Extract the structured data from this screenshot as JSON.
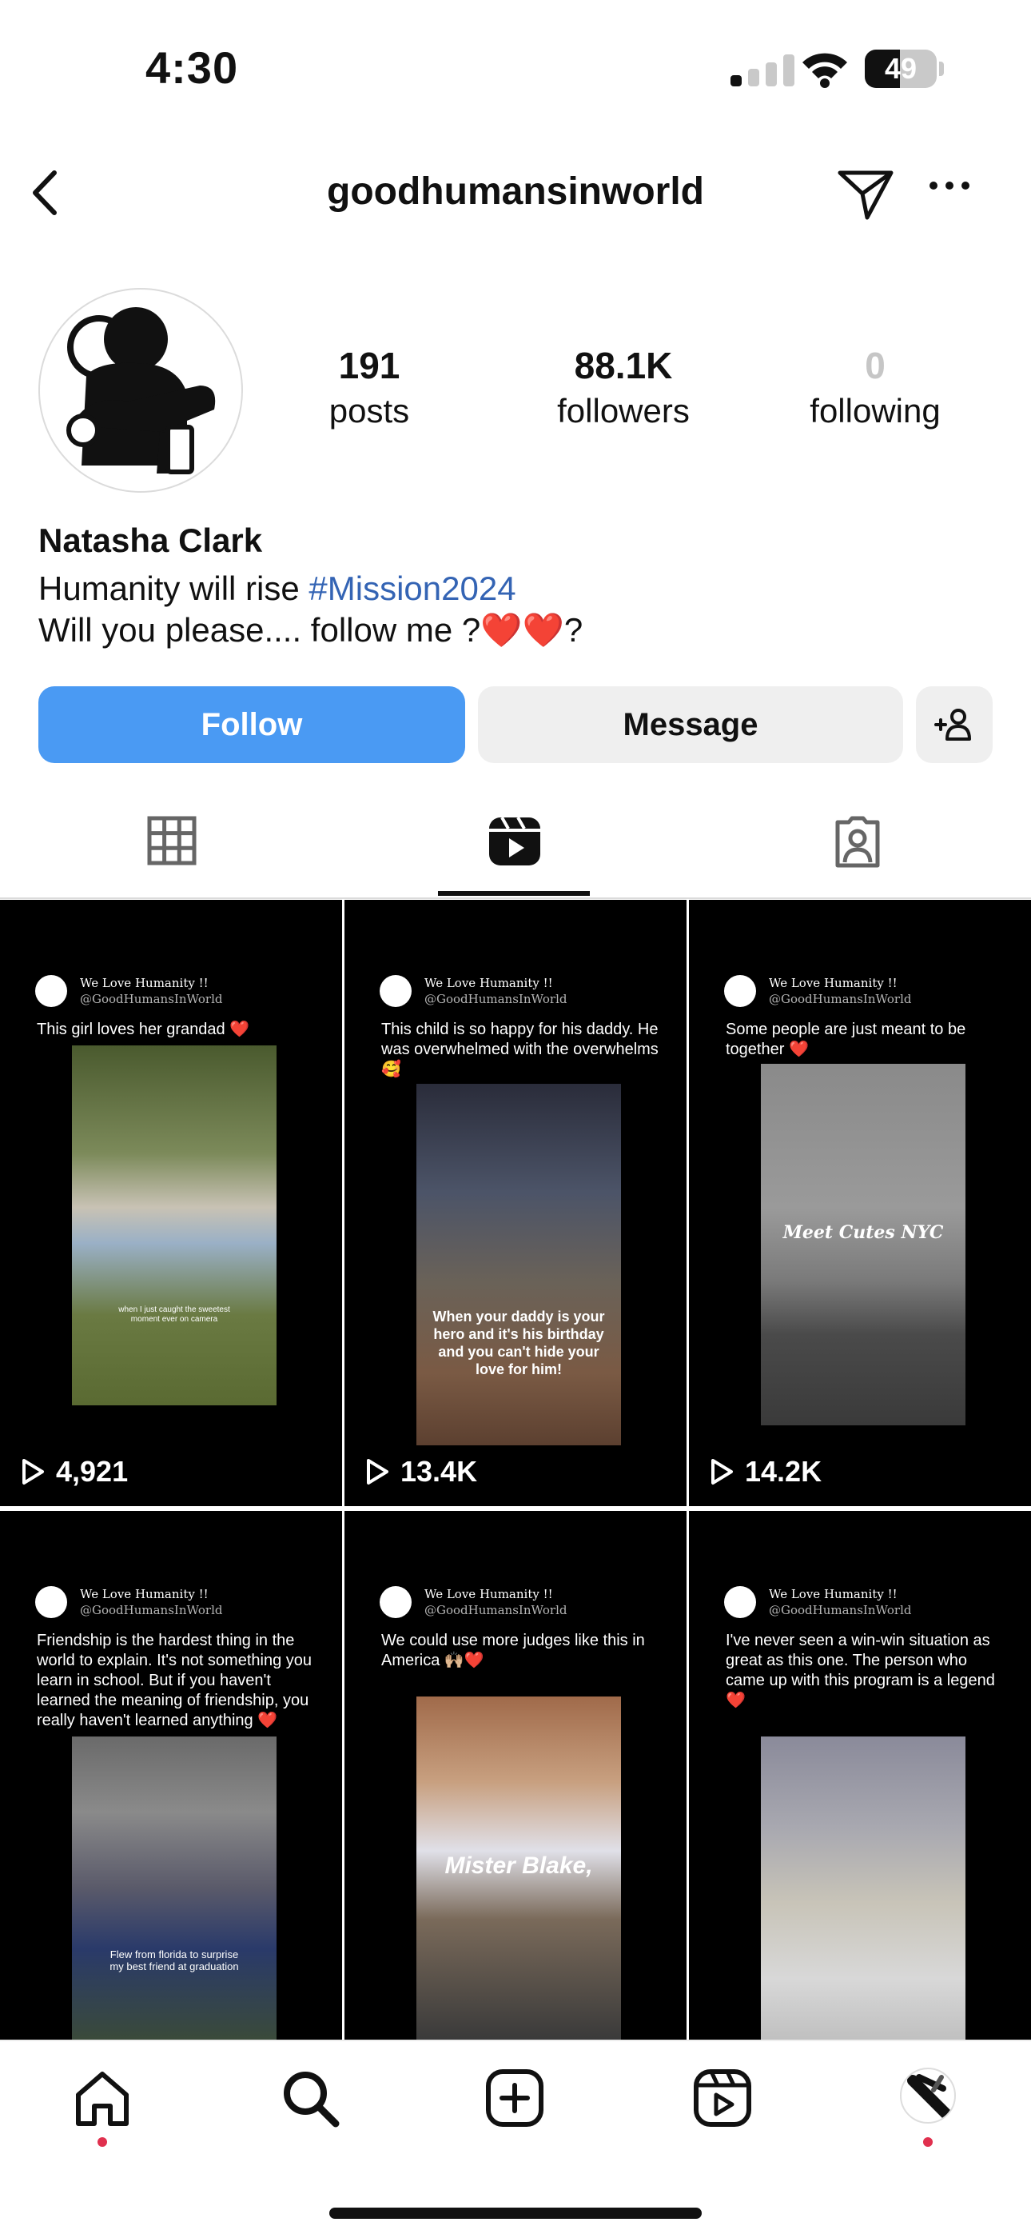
{
  "status_bar": {
    "time": "4:30",
    "battery": "49",
    "battery_level": 0.49
  },
  "header": {
    "username": "goodhumansinworld"
  },
  "profile": {
    "stats": [
      {
        "value": "191",
        "label": "posts"
      },
      {
        "value": "88.1K",
        "label": "followers"
      },
      {
        "value": "0",
        "label": "following"
      }
    ],
    "name": "Natasha Clark",
    "bio_line1_text": "Humanity will rise ",
    "bio_line1_tag": "#Mission2024",
    "bio_line2_text": "Will you please.... follow me ?",
    "bio_line2_hearts": "❤️❤️",
    "bio_line2_end": "?"
  },
  "actions": {
    "follow": "Follow",
    "message": "Message"
  },
  "icons": {
    "back": "chevron-left-icon",
    "send": "paper-plane-icon",
    "more": "more-horizontal-icon",
    "add_user": "add-user-icon",
    "grid_tab": "grid-icon",
    "reels_tab": "reels-icon",
    "tagged_tab": "tagged-icon"
  },
  "colors": {
    "accent": "#4a9af3",
    "hashtag": "#3464b4",
    "notification_dot": "#e0304e"
  },
  "posts": [
    {
      "account": "We Love Humanity !!",
      "handle": "@GoodHumansInWorld",
      "caption": "This girl loves her grandad ❤️",
      "overlay": "when I just caught the sweetest moment ever on camera",
      "views": "4,921"
    },
    {
      "account": "We Love Humanity !!",
      "handle": "@GoodHumansInWorld",
      "caption": "This child is so happy for his daddy. He was overwhelmed with the overwhelms 🥰",
      "overlay": "When your daddy is your hero and it's his birthday and you can't hide your love for him!",
      "views": "13.4K"
    },
    {
      "account": "We Love Humanity !!",
      "handle": "@GoodHumansInWorld",
      "caption": "Some people are just meant to be together ❤️",
      "overlay": "Meet Cutes NYC",
      "views": "14.2K"
    },
    {
      "account": "We Love Humanity !!",
      "handle": "@GoodHumansInWorld",
      "caption": "Friendship is the hardest thing in the world to explain. It's not something you learn in school. But if you haven't learned the meaning of friendship, you really haven't learned anything ❤️",
      "overlay": "Flew from florida to surprise my best friend at graduation",
      "views": ""
    },
    {
      "account": "We Love Humanity !!",
      "handle": "@GoodHumansInWorld",
      "caption": "We could use more judges like this in America 🙌🏼❤️",
      "overlay": "Mister Blake,",
      "views": ""
    },
    {
      "account": "We Love Humanity !!",
      "handle": "@GoodHumansInWorld",
      "caption": "I've never seen a win-win situation as great as this one. The person who came up with this program is a legend ❤️",
      "overlay": "",
      "views": ""
    }
  ],
  "bottom_nav": [
    "home-icon",
    "search-icon",
    "create-icon",
    "reels-icon",
    "profile-avatar"
  ]
}
